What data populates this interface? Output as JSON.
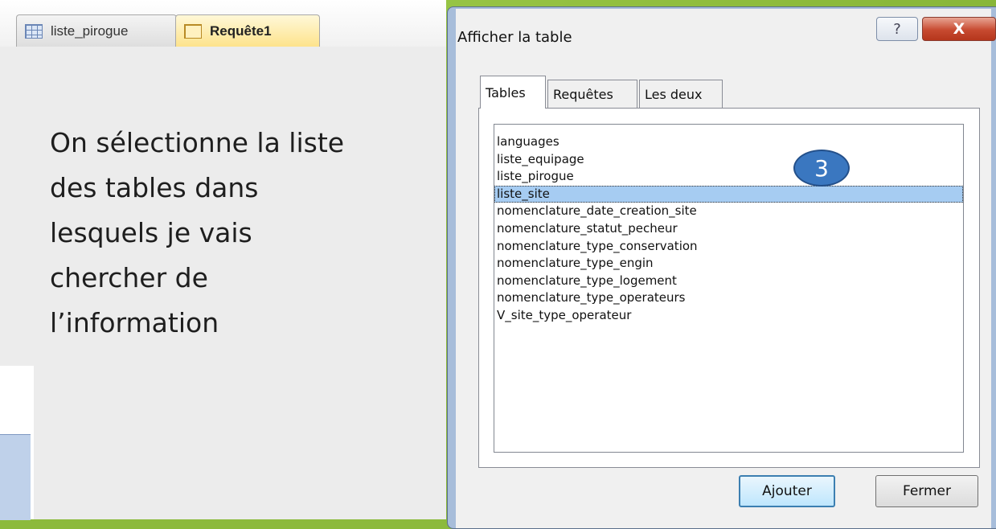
{
  "access": {
    "tabs": [
      {
        "label": "liste_pirogue",
        "icon": "table-icon"
      },
      {
        "label": "Requête1",
        "icon": "query-icon"
      }
    ]
  },
  "slide": {
    "lines": [
      "On sélectionne la liste",
      "des tables dans",
      "lesquels je vais",
      "chercher de",
      "l’information"
    ]
  },
  "dialog": {
    "title": "Afficher la table",
    "help_label": "?",
    "close_label": "X",
    "tabs": [
      "Tables",
      "Requêtes",
      "Les deux"
    ],
    "active_tab": "Tables",
    "items": [
      "languages",
      "liste_equipage",
      "liste_pirogue",
      "liste_site",
      "nomenclature_date_creation_site",
      "nomenclature_statut_pecheur",
      "nomenclature_type_conservation",
      "nomenclature_type_engin",
      "nomenclature_type_logement",
      "nomenclature_type_operateurs",
      "V_site_type_operateur"
    ],
    "selected_item": "liste_site",
    "step_badge": "3",
    "add_label": "Ajouter",
    "close_button_label": "Fermer"
  },
  "colors": {
    "slide_background": "#8cba3c",
    "selection": "#a6ccf2",
    "badge": "#3a77c0"
  }
}
